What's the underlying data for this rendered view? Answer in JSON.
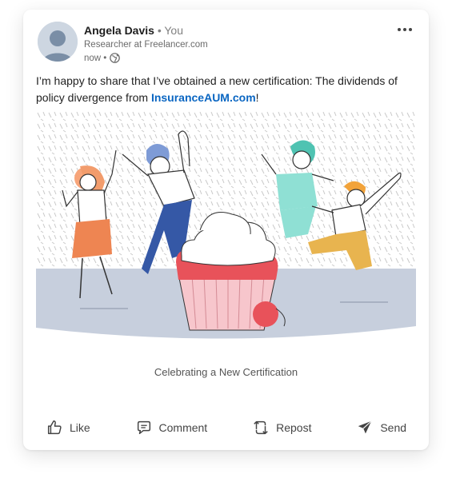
{
  "post": {
    "author": {
      "name": "Angela Davis",
      "relation": "• You",
      "headline": "Researcher at Freelancer.com",
      "time": "now •"
    },
    "text_before": "I’m happy to share that I’ve obtained a new certification: The dividends of policy divergence from ",
    "link_text": "InsuranceAUM.com",
    "text_after": "!",
    "caption": "Celebrating a New Certification"
  },
  "actions": {
    "like": "Like",
    "comment": "Comment",
    "repost": "Repost",
    "send": "Send"
  },
  "icons": {
    "more": "more-horizontal-icon",
    "visibility": "globe-icon",
    "like": "thumbs-up-icon",
    "comment": "comment-icon",
    "repost": "repost-icon",
    "send": "send-icon"
  },
  "colors": {
    "link": "#0a66c2",
    "cupcake_frosting": "#e8525a",
    "cupcake_wrapper": "#f7c6cc",
    "ground": "#c7cfdd"
  }
}
